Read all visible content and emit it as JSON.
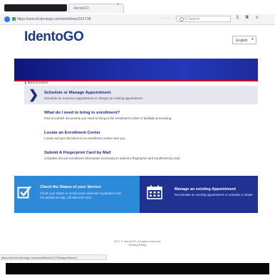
{
  "browser": {
    "tab_title": "IdentoGO",
    "url": "https://uenroll.identogo.com/workflows/1K1738",
    "search_placeholder": "Q Search",
    "page_actions": "··· ♡ ☆",
    "toolbar_icons": "⫼ ▣ ≡",
    "tab_close": "×",
    "status_url": "https://uenroll.identogo.com/workflows/1K1738/appointment"
  },
  "header": {
    "logo": "IdentoGO",
    "language": "English"
  },
  "back_link": "❮ Back to Home",
  "options": [
    {
      "title": "Schedule or Manage Appointment",
      "desc": "Schedule an in-person appointment or change an existing appointment."
    },
    {
      "title": "What do I need to bring to enrollment?",
      "desc": "Find out which documents you need to bring to the enrollment center to facilitate processing."
    },
    {
      "title": "Locate an Enrollment Center",
      "desc": "Locate and get directions to an enrollment center near you."
    },
    {
      "title": "Submit A Fingerprint Card by Mail",
      "desc": "Complete the pre-enrollment information necessary to submit a fingerprint card enrollment by mail."
    }
  ],
  "cards": {
    "status": {
      "title": "Check the Status of your Service",
      "line1": "Check your status or resend your Universal registration form",
      "line2": "For additional help, call 855-643-7404"
    },
    "manage": {
      "title": "Manage an existing Appointment",
      "line1": "Reschedule an existing appointment or schedule a rebate"
    }
  },
  "footer": {
    "copyright": "2017 © IdentoGO. All rights reserved.",
    "privacy": "Privacy Policy"
  },
  "colors": {
    "brand_blue": "#1c3a8c",
    "band_dark": "#10167a",
    "accent_red": "#c8102e",
    "status_card": "#2d8ad8",
    "manage_card": "#1f3191"
  }
}
